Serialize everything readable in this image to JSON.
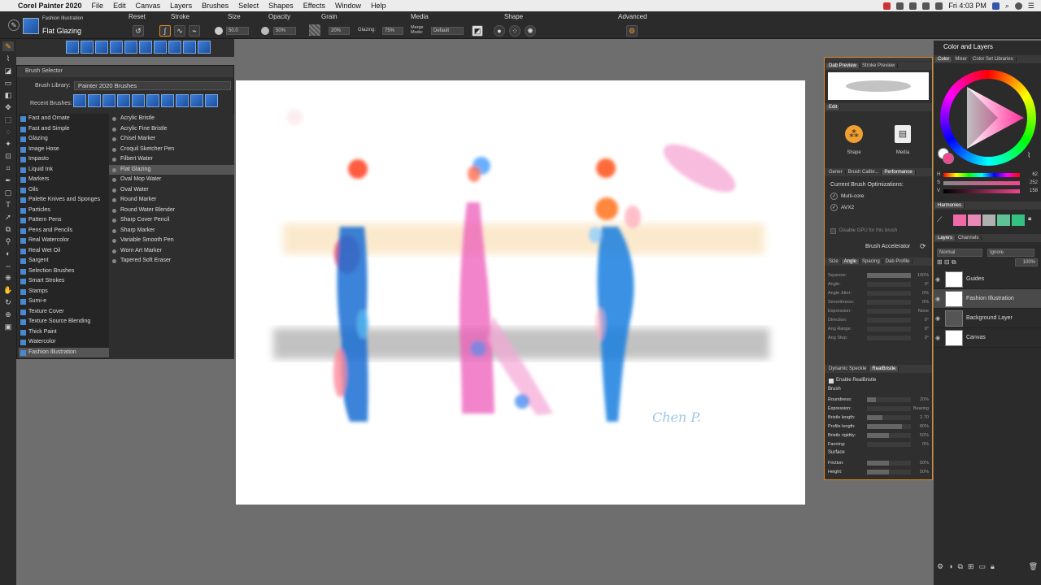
{
  "menubar": {
    "app": "Corel Painter 2020",
    "items": [
      "File",
      "Edit",
      "Canvas",
      "Layers",
      "Brushes",
      "Select",
      "Shapes",
      "Effects",
      "Window",
      "Help"
    ],
    "clock": "Fri 4:03 PM"
  },
  "propbar": {
    "category": "Fashion Illustration",
    "variant": "Flat Glazing",
    "reset": "Reset",
    "stroke": "Stroke",
    "size_label": "Size",
    "size_value": "50.0",
    "opacity_label": "Opacity",
    "opacity_value": "50%",
    "grain_label": "Grain",
    "grain_value": "20%",
    "glazing_label": "Glazing:",
    "glazing_value": "75%",
    "media_label": "Media",
    "merge_mode_label": "Merge Mode:",
    "merge_mode_value": "Default",
    "shape_label": "Shape",
    "advanced_label": "Advanced"
  },
  "brush_selector": {
    "title": "Brush Selector",
    "library_label": "Brush Library:",
    "library_value": "Painter 2020 Brushes",
    "recent_label": "Recent Brushes:",
    "categories": [
      "Fast and Ornate",
      "Fast and Simple",
      "Glazing",
      "Image Hose",
      "Impasto",
      "Liquid Ink",
      "Markers",
      "Oils",
      "Palette Knives and Sponges",
      "Particles",
      "Pattern Pens",
      "Pens and Pencils",
      "Real Watercolor",
      "Real Wet Oil",
      "Sargent",
      "Selection Brushes",
      "Smart Strokes",
      "Stamps",
      "Sumi-e",
      "Texture Cover",
      "Texture Source Blending",
      "Thick Paint",
      "Watercolor",
      "Fashion Illustration"
    ],
    "selected_category": 23,
    "variants": [
      "Acrylic Bristle",
      "Acrylic Fine Bristle",
      "Chisel Marker",
      "Croquil Sketcher Pen",
      "Filbert Water",
      "Flat Glazing",
      "Oval Mop Water",
      "Oval Water",
      "Round Marker",
      "Round Water Blender",
      "Sharp Cover Pencil",
      "Sharp Marker",
      "Variable Smooth Pen",
      "Worn Art Marker",
      "Tapered Soft Eraser"
    ],
    "selected_variant": 5
  },
  "midpanel": {
    "tabs1": [
      "Dab Preview",
      "Stroke Preview"
    ],
    "edit_tab": "Edit",
    "shape_btn": "Shape",
    "media_btn": "Media",
    "tabs2": [
      "Gener",
      "Brush Calibr...",
      "Performance"
    ],
    "optim_title": "Current Brush Optimizations:",
    "opt1": "Multi-core",
    "opt2": "AVX2",
    "gpu": "Disable GPU for this brush",
    "accelerator": "Brush Accelerator",
    "tabs3": [
      "Size",
      "Angle",
      "Spacing",
      "Dab Profile"
    ],
    "angle_rows": [
      {
        "label": "Squeeze:",
        "value": "100%",
        "fill": 1.0
      },
      {
        "label": "Angle:",
        "value": "0°",
        "fill": 0.0
      },
      {
        "label": "Angle Jitter:",
        "value": "0%",
        "fill": 0.0
      },
      {
        "label": "Smoothness:",
        "value": "0%",
        "fill": 0.0
      },
      {
        "label": "Expression:",
        "value": "None",
        "fill": 0.0
      },
      {
        "label": "Direction:",
        "value": "0°",
        "fill": 0.0
      },
      {
        "label": "Ang Range:",
        "value": "0°",
        "fill": 0.0
      },
      {
        "label": "Ang Step:",
        "value": "0°",
        "fill": 0.0
      }
    ],
    "tabs4": [
      "Dynamic Speckle",
      "RealBristle"
    ],
    "enable_rb": "Enable RealBristle",
    "brush_hdr": "Brush",
    "rb_rows": [
      {
        "label": "Roundness:",
        "value": "20%",
        "fill": 0.2
      },
      {
        "label": "Expression:",
        "value": "Bearing",
        "fill": 0.0
      },
      {
        "label": "Bristle length:",
        "value": "2.70",
        "fill": 0.35
      },
      {
        "label": "Profile length:",
        "value": "80%",
        "fill": 0.8
      },
      {
        "label": "Bristle rigidity:",
        "value": "50%",
        "fill": 0.5
      },
      {
        "label": "Fanning:",
        "value": "0%",
        "fill": 0.0
      }
    ],
    "surface_hdr": "Surface",
    "surface_rows": [
      {
        "label": "Friction:",
        "value": "50%",
        "fill": 0.5
      },
      {
        "label": "Height:",
        "value": "50%",
        "fill": 0.5
      }
    ]
  },
  "color_panel": {
    "title": "Color and Layers",
    "tabs": [
      "Color",
      "Mixer",
      "Color Set Libraries"
    ],
    "hsv": [
      {
        "label": "H",
        "value": "62"
      },
      {
        "label": "S",
        "value": "252"
      },
      {
        "label": "V",
        "value": "158"
      }
    ],
    "harmonies": "Harmonies",
    "swatches": [
      "#f06aa8",
      "#e889b8",
      "#b0b0b0",
      "#5ec296",
      "#34c080"
    ],
    "layers_tabs": [
      "Layers",
      "Channels"
    ],
    "composite": "Normal",
    "preserve": "Ignore",
    "opacity": "100%",
    "layers": [
      {
        "name": "Guides",
        "selected": false
      },
      {
        "name": "Fashion Illustration",
        "selected": true
      },
      {
        "name": "Background Layer",
        "selected": false
      },
      {
        "name": "Canvas",
        "selected": false
      }
    ]
  },
  "artwork": {
    "signature": "Chen P."
  }
}
